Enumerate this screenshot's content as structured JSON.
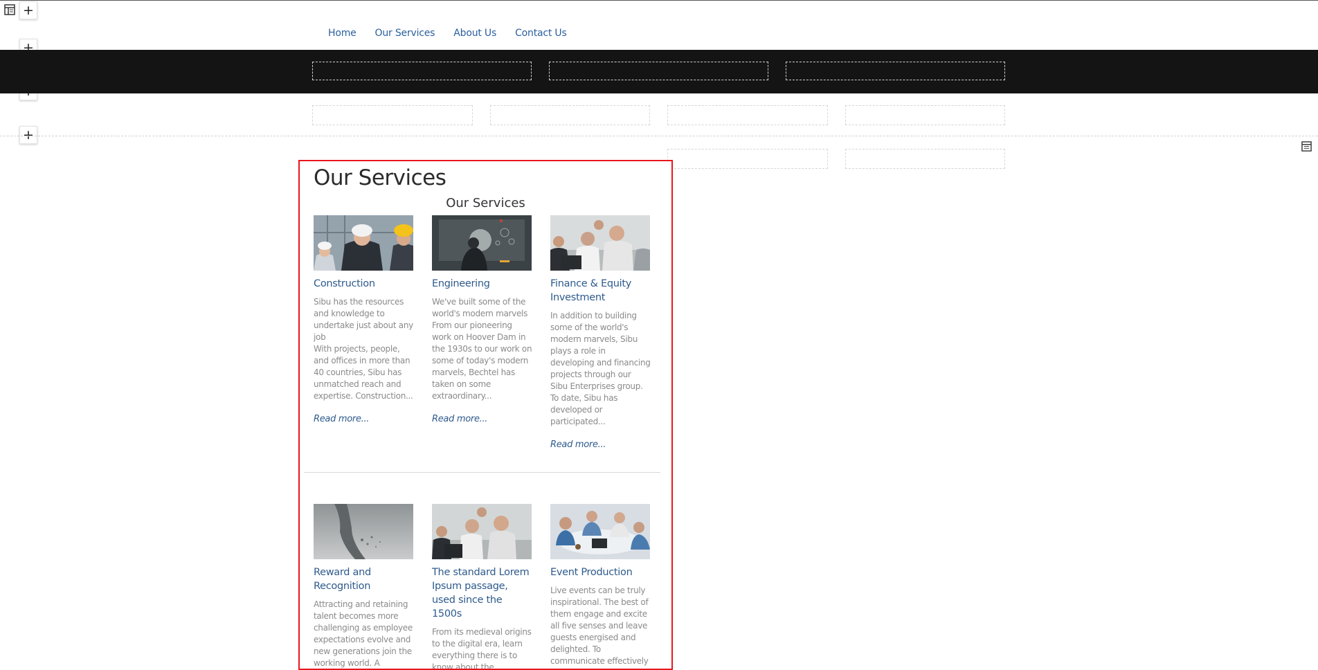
{
  "nav": {
    "items": [
      {
        "label": "Home"
      },
      {
        "label": "Our Services"
      },
      {
        "label": "About Us"
      },
      {
        "label": "Contact Us"
      }
    ]
  },
  "editor": {
    "add_glyph": "+",
    "icons": [
      "layout-icon",
      "add-icon",
      "settings-icon"
    ]
  },
  "module": {
    "heading": "Our Services",
    "section_title": "Our Services",
    "accent_color": "#e8151d",
    "cards": [
      {
        "title": "Construction",
        "description": "Sibu has the resources and knowledge to undertake just about any job\nWith projects, people, and offices in more than 40 countries, Sibu has unmatched reach and expertise. Construction...",
        "link": "Read more..."
      },
      {
        "title": "Engineering",
        "description": "We've built some of the world's modern marvels From our pioneering work on Hoover Dam in the 1930s to our work on some of today's modern marvels, Bechtel has taken on some extraordinary...",
        "link": "Read more..."
      },
      {
        "title": "Finance & Equity Investment",
        "description": "In addition to building some of the world's modern marvels, Sibu plays a role in developing and financing projects through our Sibu Enterprises group. To date, Sibu has developed or participated...",
        "link": "Read more..."
      },
      {
        "title": "Reward and Recognition",
        "description": "Attracting and retaining talent becomes more challenging as employee expectations evolve and new generations join the working world. A",
        "link": ""
      },
      {
        "title": "The standard Lorem Ipsum passage, used since the 1500s",
        "description": "From its medieval origins to the digital era, learn everything there is to know about the ubiquitous lorem",
        "link": ""
      },
      {
        "title": "Event Production",
        "description": "Live events can be truly inspirational. The best of them engage and excite all five senses and leave guests energised and delighted. To communicate effectively",
        "link": ""
      }
    ]
  }
}
